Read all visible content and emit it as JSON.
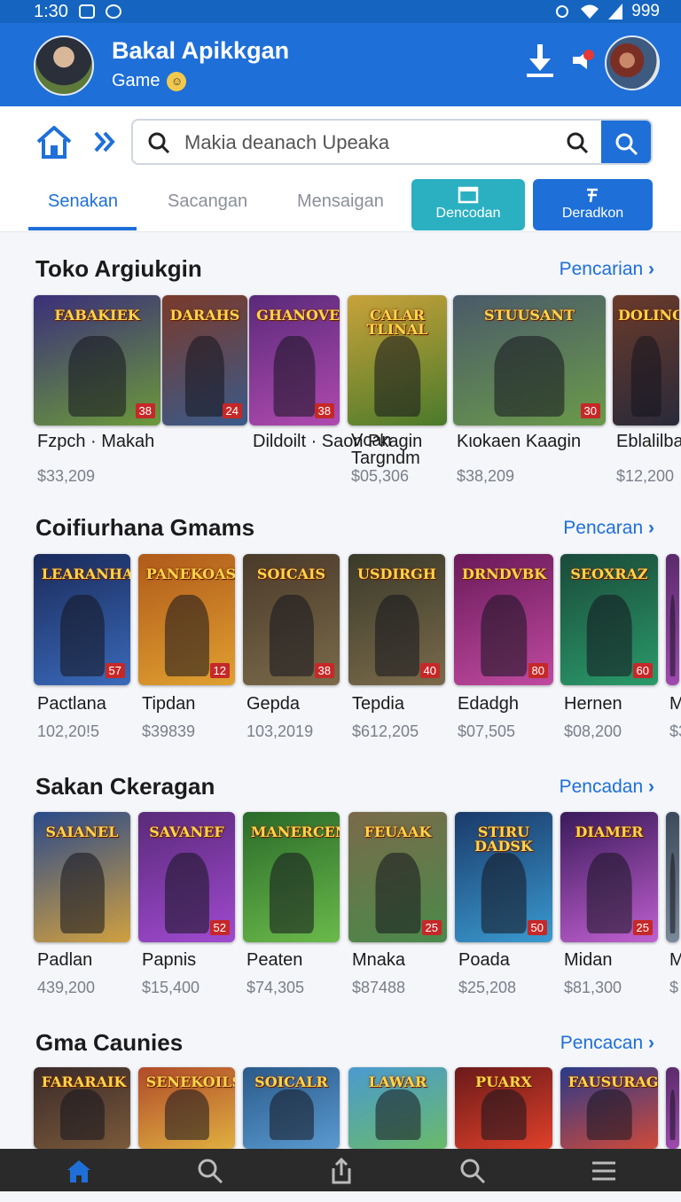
{
  "status": {
    "time": "1:30",
    "battery": "999"
  },
  "app": {
    "title": "Bakal Apikkgan",
    "subtitle": "Game"
  },
  "search": {
    "placeholder": "Makia deanach Upeaka"
  },
  "tabs": [
    {
      "label": "Senakan",
      "active": true
    },
    {
      "label": "Sacangan",
      "active": false
    },
    {
      "label": "Mensaigan",
      "active": false
    }
  ],
  "actions": [
    {
      "label": "Dencodan",
      "color": "#2bb0c2"
    },
    {
      "label": "Deradkon",
      "color": "#1e6fd8"
    }
  ],
  "sections": [
    {
      "title": "Toko Argiukgin",
      "link": "Pencarian",
      "items": [
        {
          "name": "Fzpch · Makah",
          "price": "$33,209"
        },
        {
          "name": "Dildoilt · Saon  Pkagin",
          "price": ""
        },
        {
          "name": "Vcan Targndm",
          "price": "$05,306"
        },
        {
          "name": "Kιokaen  Kaagin",
          "price": "$38,209"
        },
        {
          "name": "Eblalilbar",
          "price": "$12,200"
        }
      ]
    },
    {
      "title": "Coifiurhana Gmams",
      "link": "Pencaran",
      "items": [
        {
          "name": "Pactlana",
          "price": "102,20!5"
        },
        {
          "name": "Tipdan",
          "price": "$39839"
        },
        {
          "name": "Gepda",
          "price": "103,2019"
        },
        {
          "name": "Tepdia",
          "price": "$612,205"
        },
        {
          "name": "Edadgh",
          "price": "$07,505"
        },
        {
          "name": "Hernen",
          "price": "$08,200"
        },
        {
          "name": "M",
          "price": "$3"
        }
      ]
    },
    {
      "title": "Sakan Ckeragan",
      "link": "Pencadan",
      "items": [
        {
          "name": "Padlan",
          "price": "439,200"
        },
        {
          "name": "Papnis",
          "price": "$15,400"
        },
        {
          "name": "Peaten",
          "price": "$74,305"
        },
        {
          "name": "Mnaka",
          "price": "$87488"
        },
        {
          "name": "Poada",
          "price": "$25,208"
        },
        {
          "name": "Midan",
          "price": "$81,300"
        },
        {
          "name": "M",
          "price": "$"
        }
      ]
    },
    {
      "title": "Gma Caunies",
      "link": "Pencacan",
      "items": [
        {
          "name": "",
          "price": ""
        },
        {
          "name": "",
          "price": ""
        },
        {
          "name": "",
          "price": ""
        },
        {
          "name": "",
          "price": ""
        },
        {
          "name": "",
          "price": ""
        },
        {
          "name": "",
          "price": ""
        },
        {
          "name": "",
          "price": ""
        }
      ]
    }
  ],
  "thumbnails": {
    "row1": [
      {
        "logo": "FABAKIEK",
        "badge": "38",
        "colors": [
          "#3b2f7a",
          "#6b9a3a"
        ]
      },
      {
        "logo": "DARAHS",
        "badge": "24",
        "colors": [
          "#7a3a2a",
          "#3a5a8a"
        ]
      },
      {
        "logo": "GHANOVEK",
        "badge": "38",
        "colors": [
          "#5a2a7a",
          "#b04ab0"
        ]
      },
      {
        "logo": "CALAR TLINAL",
        "badge": "",
        "colors": [
          "#c9a23a",
          "#4a7a2a"
        ]
      },
      {
        "logo": "STUUSANT",
        "badge": "30",
        "colors": [
          "#4a5a6a",
          "#6a9a4a"
        ]
      },
      {
        "logo": "DOLINOU",
        "badge": "",
        "colors": [
          "#6a3a2a",
          "#2a2a3a"
        ]
      }
    ],
    "row2": [
      {
        "logo": "LEARANHAR",
        "badge": "57",
        "colors": [
          "#1a2a5a",
          "#3a6aba"
        ]
      },
      {
        "logo": "PANEKOAS",
        "badge": "12",
        "colors": [
          "#b05a1a",
          "#e0a030"
        ]
      },
      {
        "logo": "SOICAIS",
        "badge": "38",
        "colors": [
          "#4a3a2a",
          "#7a6a4a"
        ]
      },
      {
        "logo": "USDIRGH",
        "badge": "40",
        "colors": [
          "#3a3a2a",
          "#7a6a4a"
        ]
      },
      {
        "logo": "DRNDVBK",
        "badge": "80",
        "colors": [
          "#6a1a5a",
          "#c04aa0"
        ]
      },
      {
        "logo": "SEOXRAZ",
        "badge": "60",
        "colors": [
          "#1a4a3a",
          "#2a9a6a"
        ]
      },
      {
        "logo": "",
        "badge": "",
        "colors": [
          "#5a2a6a",
          "#a04ab0"
        ]
      }
    ],
    "row3": [
      {
        "logo": "SAIANEL",
        "badge": "",
        "colors": [
          "#2a4a8a",
          "#d0a040"
        ]
      },
      {
        "logo": "SAVANEF",
        "badge": "52",
        "colors": [
          "#5a2a7a",
          "#a04ad0"
        ]
      },
      {
        "logo": "MANERCENEY",
        "badge": "",
        "colors": [
          "#2a6a2a",
          "#6aba4a"
        ]
      },
      {
        "logo": "FEUAAK",
        "badge": "25",
        "colors": [
          "#7a6a4a",
          "#4a8a4a"
        ]
      },
      {
        "logo": "STIRU DADSK",
        "badge": "50",
        "colors": [
          "#1a3a6a",
          "#3a9ad0"
        ]
      },
      {
        "logo": "DIAMER",
        "badge": "25",
        "colors": [
          "#3a1a5a",
          "#c060d0"
        ]
      },
      {
        "logo": "",
        "badge": "",
        "colors": [
          "#3a4a5a",
          "#7a8a9a"
        ]
      }
    ],
    "row4": [
      {
        "logo": "FARARAIK",
        "badge": "",
        "colors": [
          "#3a2a2a",
          "#7a5a3a"
        ]
      },
      {
        "logo": "SENEKOILS",
        "badge": "",
        "colors": [
          "#b04a2a",
          "#e0b040"
        ]
      },
      {
        "logo": "SOICALR",
        "badge": "",
        "colors": [
          "#2a5a8a",
          "#5a9ad0"
        ]
      },
      {
        "logo": "LAWAR",
        "badge": "",
        "colors": [
          "#4a9ad0",
          "#6aba6a"
        ]
      },
      {
        "logo": "PUARX",
        "badge": "",
        "colors": [
          "#6a1a1a",
          "#e0402a"
        ]
      },
      {
        "logo": "FAUSURAG",
        "badge": "",
        "colors": [
          "#2a3a8a",
          "#d04a3a"
        ]
      },
      {
        "logo": "",
        "badge": "",
        "colors": [
          "#5a2a6a",
          "#a04ab0"
        ]
      }
    ]
  },
  "bottom_nav": [
    "home-icon",
    "search-icon",
    "share-icon",
    "search-icon",
    "menu-icon"
  ]
}
